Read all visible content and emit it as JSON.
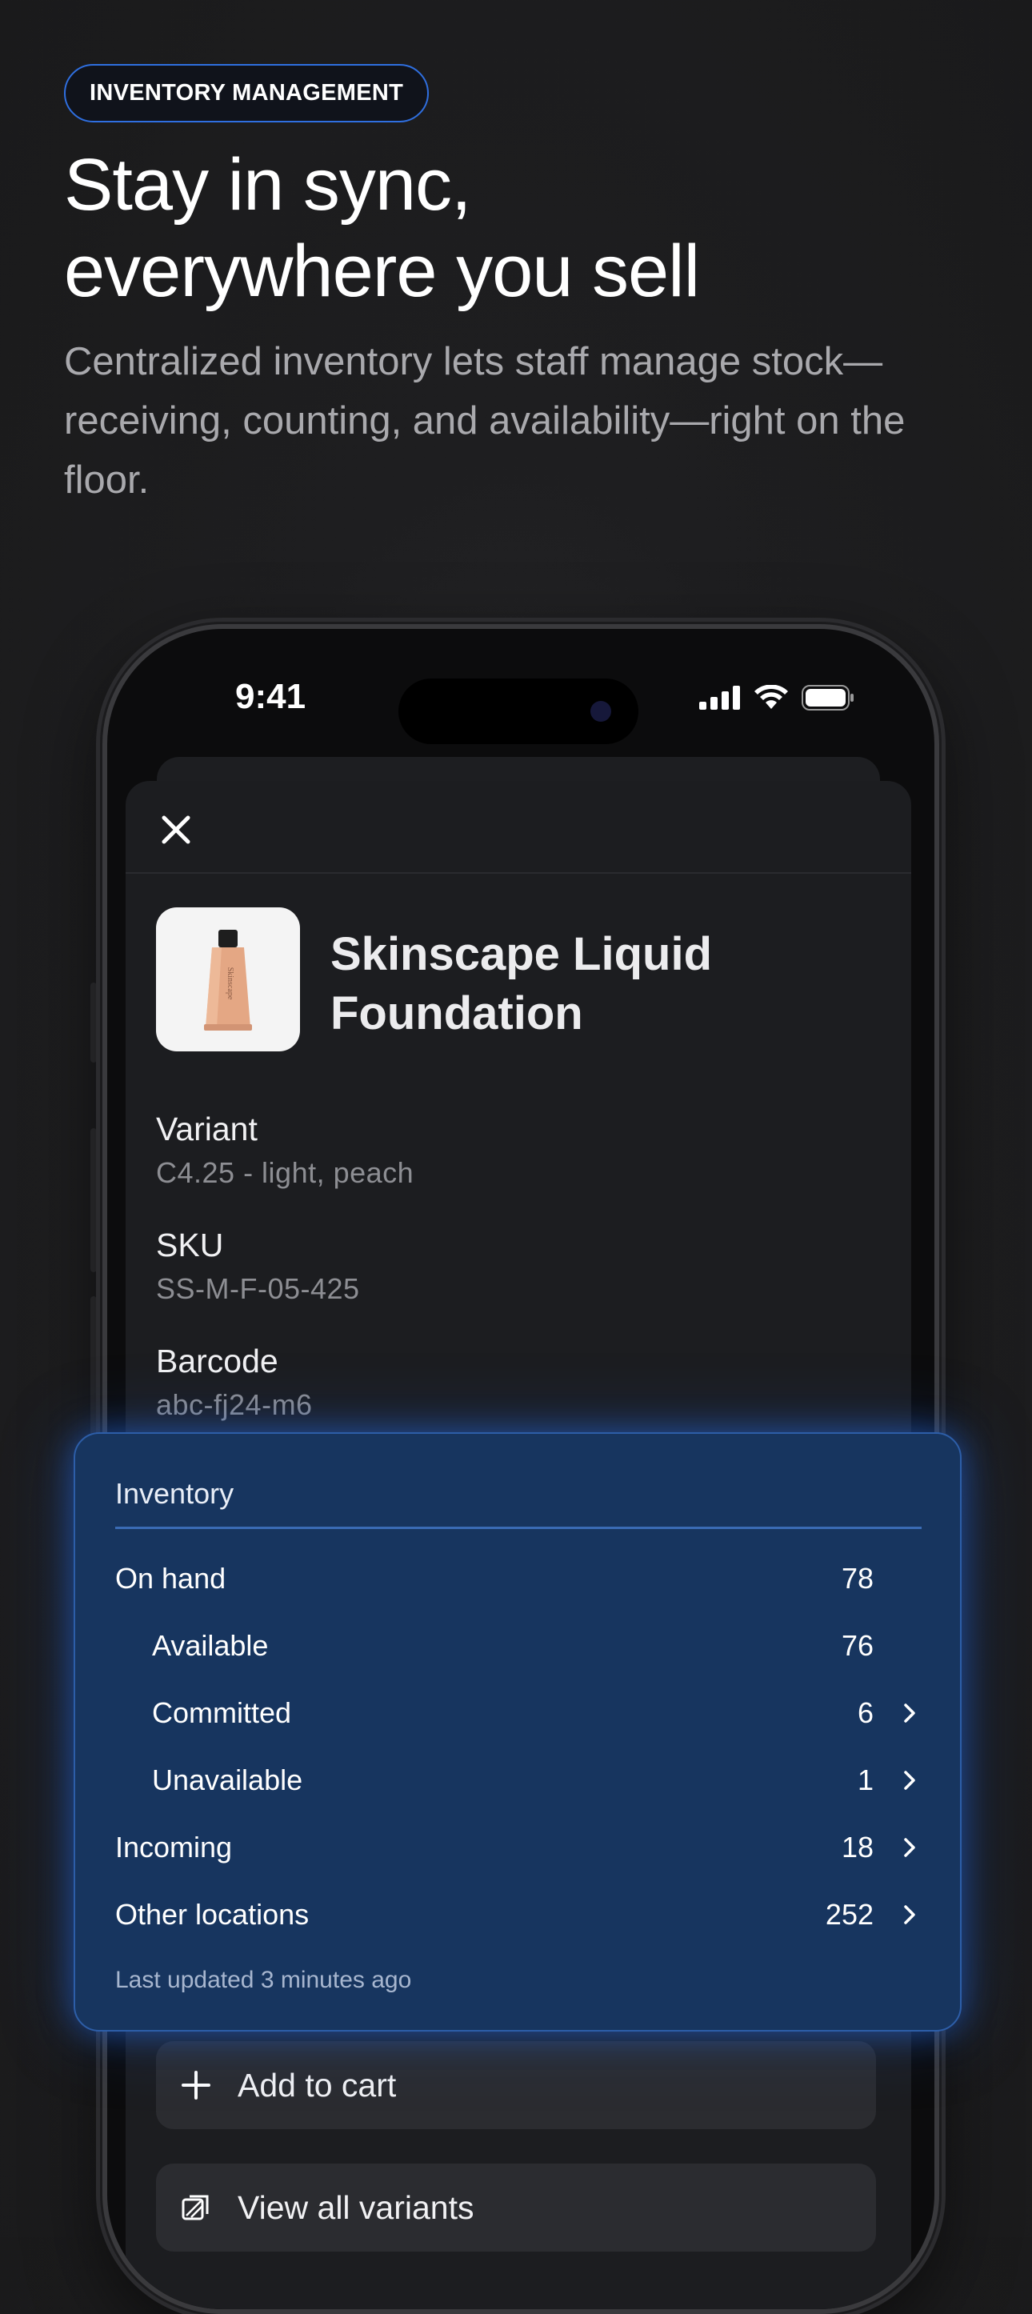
{
  "hero": {
    "badge": "INVENTORY MANAGEMENT",
    "headline": "Stay in sync,\neverywhere you sell",
    "subtitle": "Centralized inventory lets staff manage stock—receiving, counting, and availability—right on the floor."
  },
  "status_bar": {
    "time": "9:41"
  },
  "product": {
    "title": "Skinscape Liquid Foundation",
    "thumbnail_text": "Skinscape",
    "fields": [
      {
        "label": "Variant",
        "value": "C4.25 - light, peach"
      },
      {
        "label": "SKU",
        "value": "SS-M-F-05-425"
      },
      {
        "label": "Barcode",
        "value": "abc-fj24-m6"
      }
    ]
  },
  "inventory": {
    "title": "Inventory",
    "rows": [
      {
        "name": "On hand",
        "value": "78",
        "chevron": false,
        "indent": false
      },
      {
        "name": "Available",
        "value": "76",
        "chevron": false,
        "indent": true
      },
      {
        "name": "Committed",
        "value": "6",
        "chevron": true,
        "indent": true
      },
      {
        "name": "Unavailable",
        "value": "1",
        "chevron": true,
        "indent": true
      },
      {
        "name": "Incoming",
        "value": "18",
        "chevron": true,
        "indent": false
      },
      {
        "name": "Other locations",
        "value": "252",
        "chevron": true,
        "indent": false
      }
    ],
    "footer": "Last updated 3 minutes ago"
  },
  "actions": {
    "add_to_cart": "Add to cart",
    "view_variants": "View all variants"
  },
  "colors": {
    "accent": "#2f6fe0",
    "card": "#17355f"
  }
}
